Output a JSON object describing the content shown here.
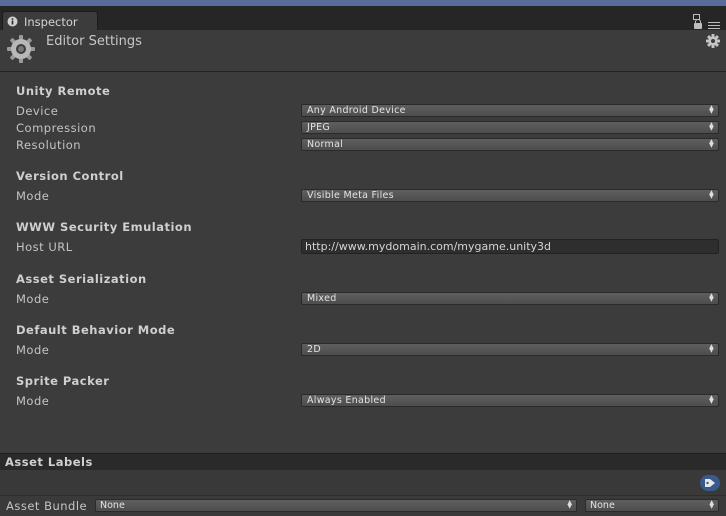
{
  "window": {
    "tab_label": "Inspector"
  },
  "header": {
    "title": "Editor Settings"
  },
  "unity_remote": {
    "title": "Unity Remote",
    "device_label": "Device",
    "device_value": "Any Android Device",
    "compression_label": "Compression",
    "compression_value": "JPEG",
    "resolution_label": "Resolution",
    "resolution_value": "Normal"
  },
  "version_control": {
    "title": "Version Control",
    "mode_label": "Mode",
    "mode_value": "Visible Meta Files"
  },
  "www_security": {
    "title": "WWW Security Emulation",
    "host_label": "Host URL",
    "host_value": "http://www.mydomain.com/mygame.unity3d"
  },
  "asset_serialization": {
    "title": "Asset Serialization",
    "mode_label": "Mode",
    "mode_value": "Mixed"
  },
  "default_behavior": {
    "title": "Default Behavior Mode",
    "mode_label": "Mode",
    "mode_value": "2D"
  },
  "sprite_packer": {
    "title": "Sprite Packer",
    "mode_label": "Mode",
    "mode_value": "Always Enabled"
  },
  "asset_labels": {
    "title": "Asset Labels"
  },
  "asset_bundle": {
    "label": "Asset Bundle",
    "name_value": "None",
    "variant_value": "None"
  },
  "icons": [
    "info-icon",
    "maximize-icon",
    "lock-icon",
    "menu-icon",
    "gear-icon",
    "settings-gear-icon",
    "tag-icon",
    "dropdown-arrow-icon"
  ],
  "colors": {
    "panel": "#3c3c3c",
    "tab_bar": "#262626",
    "accent_tag": "#3a5a8c"
  }
}
